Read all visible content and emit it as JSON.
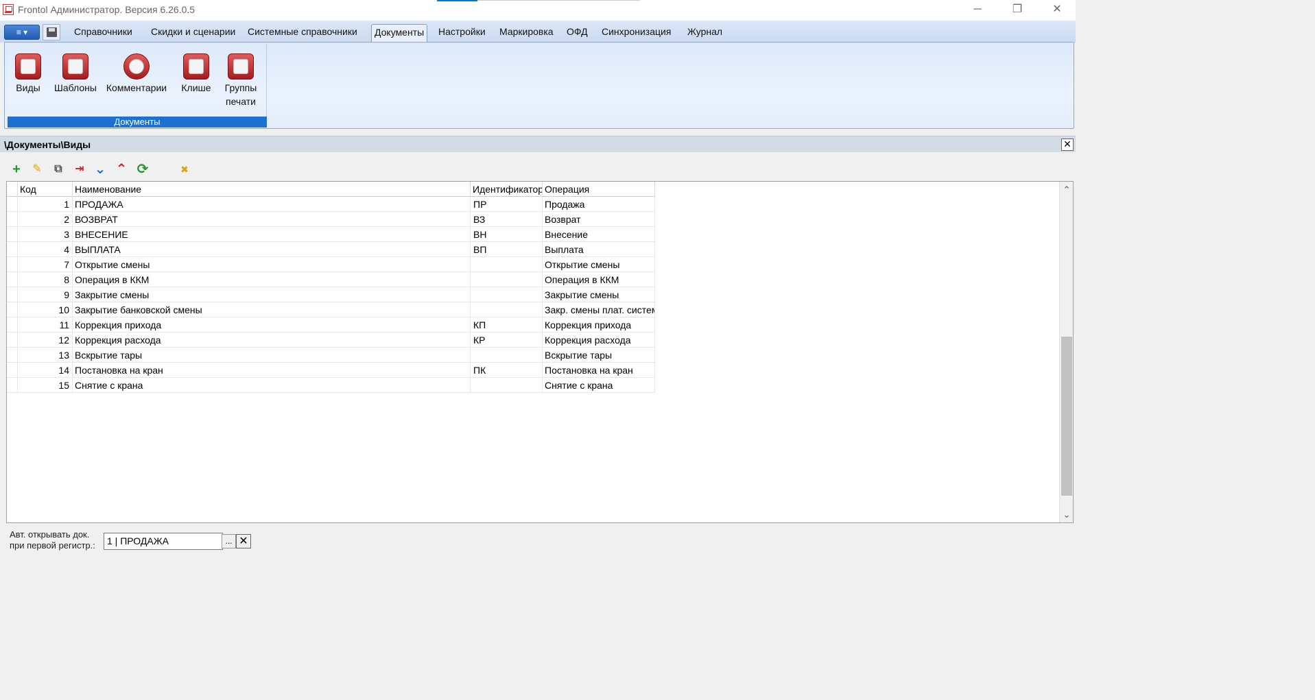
{
  "window": {
    "title": "Frontol Администратор. Версия 6.26.0.5",
    "minimize": "─",
    "maximize": "❐",
    "close": "✕"
  },
  "ribbon": {
    "app_menu_label": "≡ ▾",
    "tabs": [
      {
        "label": "Справочники"
      },
      {
        "label": "Скидки и сценарии"
      },
      {
        "label": "Системные справочники"
      },
      {
        "label": "Документы"
      },
      {
        "label": "Настройки"
      },
      {
        "label": "Маркировка"
      },
      {
        "label": "ОФД"
      },
      {
        "label": "Синхронизация"
      },
      {
        "label": "Журнал"
      }
    ],
    "active_tab": "Документы",
    "group": {
      "label": "Документы",
      "buttons": [
        {
          "label": "Виды",
          "icon": "document-types-icon"
        },
        {
          "label": "Шаблоны",
          "icon": "templates-icon"
        },
        {
          "label": "Комментарии",
          "icon": "comments-icon"
        },
        {
          "label": "Клише",
          "icon": "stamp-icon"
        },
        {
          "label": "Группы\nпечати",
          "icon": "print-groups-icon"
        }
      ]
    }
  },
  "document": {
    "path": "\\Документы\\Виды",
    "close_label": "✕"
  },
  "toolbar": {
    "add": "+",
    "edit": "✎",
    "copy": "⧉",
    "delete": "⇥",
    "move_down": "⌄",
    "move_up": "⌃",
    "refresh": "⟳",
    "clear": "✖"
  },
  "grid": {
    "columns": {
      "code": "Код",
      "name": "Наименование",
      "identifier": "Идентификатор",
      "operation": "Операция"
    },
    "rows": [
      {
        "code": "1",
        "name": "ПРОДАЖА",
        "identifier": "ПР",
        "operation": "Продажа"
      },
      {
        "code": "2",
        "name": "ВОЗВРАТ",
        "identifier": "ВЗ",
        "operation": "Возврат"
      },
      {
        "code": "3",
        "name": "ВНЕСЕНИЕ",
        "identifier": "ВН",
        "operation": "Внесение"
      },
      {
        "code": "4",
        "name": "ВЫПЛАТА",
        "identifier": "ВП",
        "operation": "Выплата"
      },
      {
        "code": "7",
        "name": "Открытие смены",
        "identifier": "",
        "operation": "Открытие смены"
      },
      {
        "code": "8",
        "name": "Операция в ККМ",
        "identifier": "",
        "operation": "Операция в ККМ"
      },
      {
        "code": "9",
        "name": "Закрытие смены",
        "identifier": "",
        "operation": "Закрытие смены"
      },
      {
        "code": "10",
        "name": "Закрытие банковской смены",
        "identifier": "",
        "operation": "Закр. смены плат. систем"
      },
      {
        "code": "11",
        "name": "Коррекция прихода",
        "identifier": "КП",
        "operation": "Коррекция прихода"
      },
      {
        "code": "12",
        "name": "Коррекция расхода",
        "identifier": "КР",
        "operation": "Коррекция расхода"
      },
      {
        "code": "13",
        "name": "Вскрытие тары",
        "identifier": "",
        "operation": "Вскрытие тары"
      },
      {
        "code": "14",
        "name": "Постановка на кран",
        "identifier": "ПК",
        "operation": "Постановка на кран"
      },
      {
        "code": "15",
        "name": "Снятие с крана",
        "identifier": "",
        "operation": "Снятие с крана"
      }
    ],
    "scroll_up": "⌃",
    "scroll_down": "⌄"
  },
  "footer": {
    "label_line1": "Авт. открывать док.",
    "label_line2": "при первой регистр.:",
    "value": "1 | ПРОДАЖА",
    "browse": "...",
    "clear": "✕"
  },
  "colors": {
    "accent": "#1d6fd1",
    "ribbon_bg": "#dde9fa",
    "icon_red": "#c23030",
    "add_green": "#1f9a2f",
    "arrow_blue": "#1f6fd6",
    "arrow_red": "#d42020"
  }
}
